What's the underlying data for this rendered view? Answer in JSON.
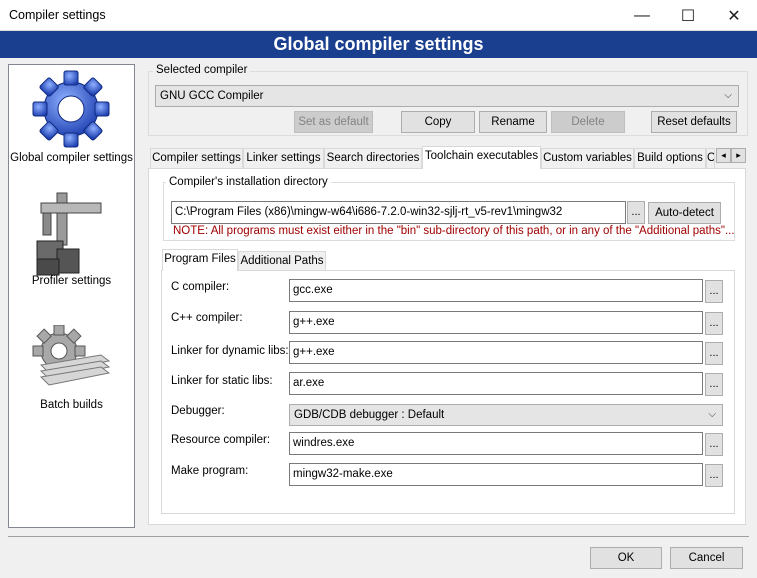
{
  "window": {
    "title": "Compiler settings",
    "minimize_glyph": "—",
    "maximize_glyph": "☐",
    "close_glyph": "✕"
  },
  "banner": {
    "title": "Global compiler settings"
  },
  "sidebar": {
    "items": [
      {
        "label": "Global compiler settings",
        "icon": "gear-icon"
      },
      {
        "label": "Profiler settings",
        "icon": "caliper-icon"
      },
      {
        "label": "Batch builds",
        "icon": "batch-gear-icon"
      }
    ]
  },
  "selected_compiler": {
    "group_title": "Selected compiler",
    "value": "GNU GCC Compiler",
    "buttons": {
      "set_default": "Set as default",
      "copy": "Copy",
      "rename": "Rename",
      "delete": "Delete",
      "reset_defaults": "Reset defaults"
    }
  },
  "tabs": [
    "Compiler settings",
    "Linker settings",
    "Search directories",
    "Toolchain executables",
    "Custom variables",
    "Build options",
    "O"
  ],
  "tab_scroll": {
    "left": "◂",
    "right": "▸"
  },
  "install_dir": {
    "group_title": "Compiler's installation directory",
    "value": "C:\\Program Files (x86)\\mingw-w64\\i686-7.2.0-win32-sjlj-rt_v5-rev1\\mingw32",
    "browse_label": "...",
    "autodetect_label": "Auto-detect",
    "note": "NOTE: All programs must exist either in the \"bin\" sub-directory of this path, or in any of the \"Additional paths\"..."
  },
  "subtabs": [
    "Program Files",
    "Additional Paths"
  ],
  "programs": {
    "c_compiler": {
      "label": "C compiler:",
      "value": "gcc.exe"
    },
    "cpp_compiler": {
      "label": "C++ compiler:",
      "value": "g++.exe"
    },
    "linker_dynamic": {
      "label": "Linker for dynamic libs:",
      "value": "g++.exe"
    },
    "linker_static": {
      "label": "Linker for static libs:",
      "value": "ar.exe"
    },
    "debugger": {
      "label": "Debugger:",
      "value": "GDB/CDB debugger : Default"
    },
    "resource_compiler": {
      "label": "Resource compiler:",
      "value": "windres.exe"
    },
    "make_program": {
      "label": "Make program:",
      "value": "mingw32-make.exe"
    },
    "browse_label": "..."
  },
  "footer": {
    "ok": "OK",
    "cancel": "Cancel"
  }
}
